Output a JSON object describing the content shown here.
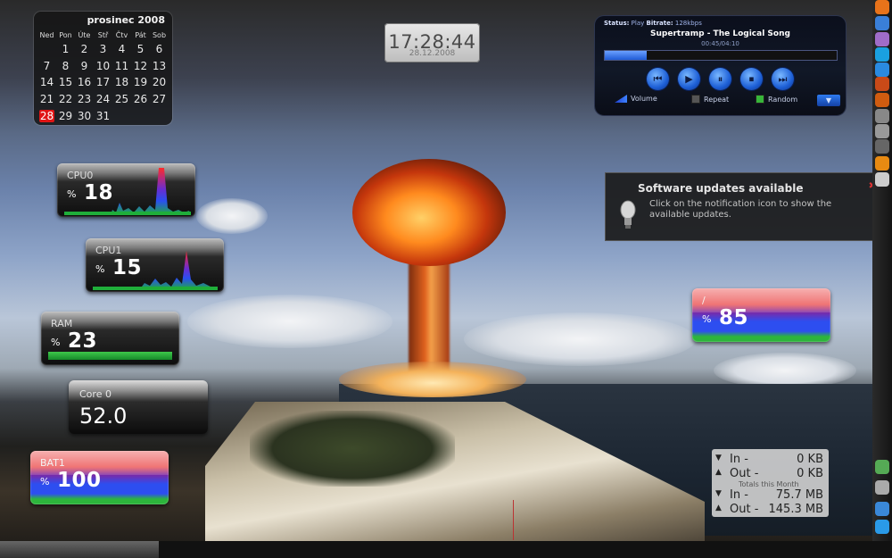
{
  "calendar": {
    "title": "prosinec 2008",
    "weekdays": [
      "Ned",
      "Pon",
      "Úte",
      "Stř",
      "Čtv",
      "Pát",
      "Sob"
    ],
    "weeks": [
      [
        "",
        "1",
        "2",
        "3",
        "4",
        "5",
        "6"
      ],
      [
        "7",
        "8",
        "9",
        "10",
        "11",
        "12",
        "13"
      ],
      [
        "14",
        "15",
        "16",
        "17",
        "18",
        "19",
        "20"
      ],
      [
        "21",
        "22",
        "23",
        "24",
        "25",
        "26",
        "27"
      ],
      [
        "28",
        "29",
        "30",
        "31",
        "",
        "",
        ""
      ]
    ],
    "today": "28",
    "today_color": "#e01515"
  },
  "clock": {
    "time": "17:28:44",
    "date": "28.12.2008"
  },
  "player": {
    "status_label": "Status:",
    "status_value": "Play",
    "bitrate_label": "Bitrate:",
    "bitrate_value": "128kbps",
    "song": "Supertramp - The Logical Song",
    "time": "00:45/04:10",
    "progress": 0.18,
    "controls": [
      {
        "icon": "previous-icon",
        "glyph": "⏮"
      },
      {
        "icon": "play-icon",
        "glyph": "▶"
      },
      {
        "icon": "pause-icon",
        "glyph": "⏸"
      },
      {
        "icon": "stop-icon",
        "glyph": "⏹"
      },
      {
        "icon": "next-icon",
        "glyph": "⏭"
      }
    ],
    "volume_label": "Volume",
    "repeat_label": "Repeat",
    "random_label": "Random",
    "repeat_on": false,
    "random_on": true,
    "accent": "#1f5bd6"
  },
  "notification": {
    "title": "Software updates available",
    "body": "Click on the notification icon to show the available updates.",
    "close_glyph": "✖",
    "icon": "lightbulb-icon"
  },
  "meters": {
    "cpu0": {
      "label": "CPU0",
      "percent_sign": "%",
      "value": "18"
    },
    "cpu1": {
      "label": "CPU1",
      "percent_sign": "%",
      "value": "15"
    },
    "ram": {
      "label": "RAM",
      "percent_sign": "%",
      "value": "23"
    },
    "root": {
      "label": "/",
      "percent_sign": "%",
      "value": "85"
    },
    "bat": {
      "label": "BAT1",
      "percent_sign": "%",
      "value": "100"
    },
    "core": {
      "label": "Core 0",
      "value": "52.0"
    }
  },
  "network": {
    "in_label": "In -",
    "in_value": "0 KB",
    "out_label": "Out -",
    "out_value": "0 KB",
    "totals_label": "Totals this Month",
    "total_in_label": "In -",
    "total_in_value": "75.7 MB",
    "total_out_label": "Out -",
    "total_out_value": "145.3 MB"
  },
  "right_panel": {
    "icons": [
      {
        "name": "firefox-icon",
        "color": "#e8731a"
      },
      {
        "name": "cube-icon",
        "color": "#3a7fd8"
      },
      {
        "name": "pidgin-icon",
        "color": "#a06cc8"
      },
      {
        "name": "skype-icon",
        "color": "#1aa0e0"
      },
      {
        "name": "globe-icon",
        "color": "#2a8ae0"
      },
      {
        "name": "paw-icon",
        "color": "#c94a18"
      },
      {
        "name": "firefox-small-icon",
        "color": "#d05c10"
      },
      {
        "name": "display-icon",
        "color": "#888888"
      },
      {
        "name": "monitor-icon",
        "color": "#999999"
      },
      {
        "name": "network-icon",
        "color": "#666666"
      },
      {
        "name": "star-icon",
        "color": "#e88a12"
      },
      {
        "name": "terminal-icon",
        "color": "#cccccc"
      },
      {
        "name": "speaker-icon",
        "color": "#55aa55"
      },
      {
        "name": "battery-icon",
        "color": "#aaaaaa"
      },
      {
        "name": "user-icon",
        "color": "#3a88d8"
      },
      {
        "name": "download-icon",
        "color": "#2a9ae8"
      }
    ]
  }
}
